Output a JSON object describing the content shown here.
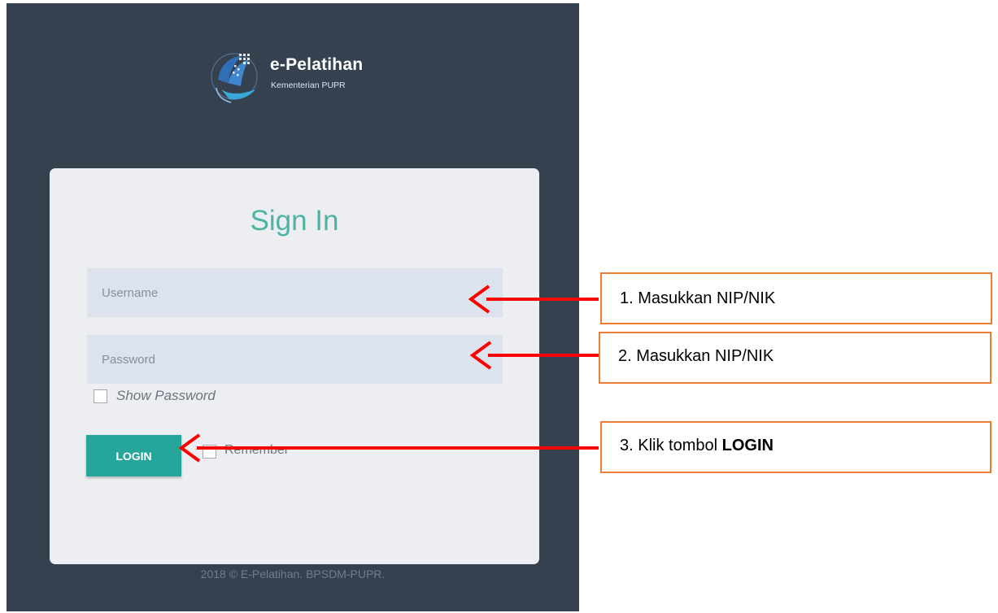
{
  "brand": {
    "title": "e-Pelatihan",
    "subtitle": "Kementerian PUPR"
  },
  "login": {
    "heading": "Sign In",
    "username_placeholder": "Username",
    "password_placeholder": "Password",
    "show_password_label": "Show Password",
    "login_button": "LOGIN",
    "remember_label": "Remember"
  },
  "footer": {
    "text": "2018 © E-Pelatihan. BPSDM-PUPR."
  },
  "annotations": [
    {
      "text": "1. Masukkan NIP/NIK"
    },
    {
      "text": "2. Masukkan NIP/NIK"
    },
    {
      "text_prefix": "3. Klik tombol ",
      "text_bold": "LOGIN"
    }
  ],
  "colors": {
    "background": "#364150",
    "card": "#eceef1",
    "heading": "#4db3a2",
    "button": "#26a69a",
    "annotation_border": "#ed7d31",
    "arrow": "#ff0000"
  }
}
